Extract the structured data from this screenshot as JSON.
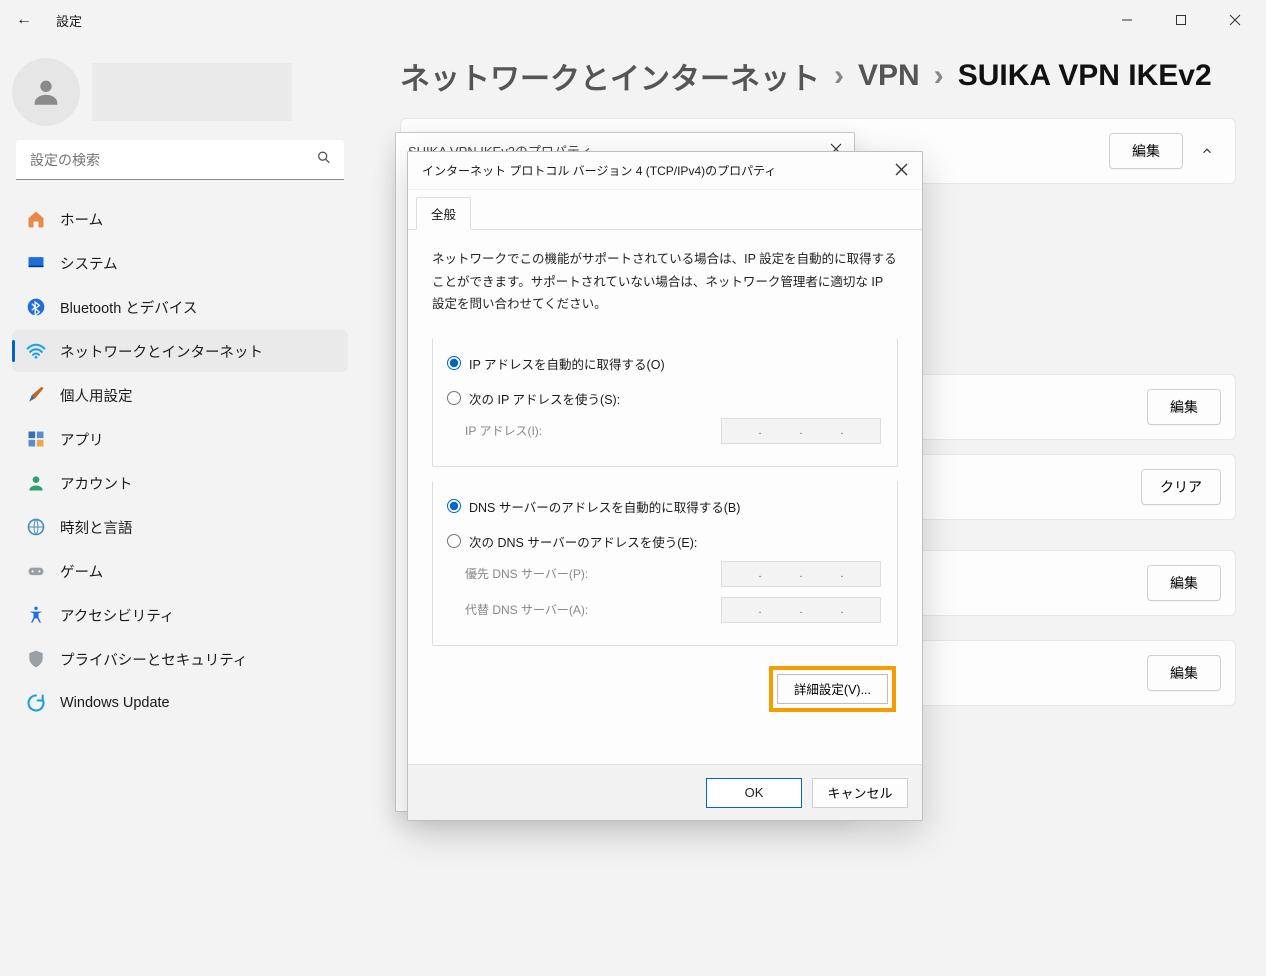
{
  "titlebar": {
    "back": "←",
    "title": "設定"
  },
  "search": {
    "placeholder": "設定の検索"
  },
  "nav": {
    "home": "ホーム",
    "system": "システム",
    "bluetooth": "Bluetooth とデバイス",
    "network": "ネットワークとインターネット",
    "personalization": "個人用設定",
    "apps": "アプリ",
    "accounts": "アカウント",
    "time": "時刻と言語",
    "gaming": "ゲーム",
    "accessibility": "アクセシビリティ",
    "privacy": "プライバシーとセキュリティ",
    "update": "Windows Update"
  },
  "breadcrumb": {
    "a": "ネットワークとインターネット",
    "b": "VPN",
    "c": "SUIKA VPN IKEv2",
    "sep": "›"
  },
  "buttons": {
    "edit": "編集",
    "clear": "クリア"
  },
  "back_dialog": {
    "title": "SUIKA VPN IKEv2のプロパティ"
  },
  "dialog": {
    "title": "インターネット プロトコル バージョン 4 (TCP/IPv4)のプロパティ",
    "tab_general": "全般",
    "desc": "ネットワークでこの機能がサポートされている場合は、IP 設定を自動的に取得することができます。サポートされていない場合は、ネットワーク管理者に適切な IP 設定を問い合わせてください。",
    "ip_auto": "IP アドレスを自動的に取得する(O)",
    "ip_manual": "次の IP アドレスを使う(S):",
    "ip_label": "IP アドレス(I):",
    "dns_auto": "DNS サーバーのアドレスを自動的に取得する(B)",
    "dns_manual": "次の DNS サーバーのアドレスを使う(E):",
    "dns_pref": "優先 DNS サーバー(P):",
    "dns_alt": "代替 DNS サーバー(A):",
    "advanced": "詳細設定(V)...",
    "ok": "OK",
    "cancel": "キャンセル"
  }
}
